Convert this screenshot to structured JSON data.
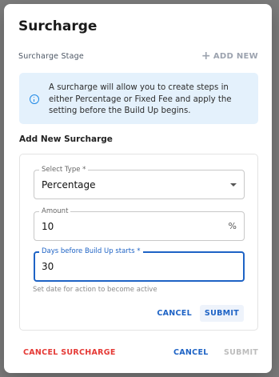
{
  "dialog": {
    "title": "Surcharge",
    "stage_label": "Surcharge Stage",
    "add_new_label": "ADD NEW",
    "info_text": "A surcharge will allow you to create steps in either Percentage or Fixed Fee and apply the setting before the Build Up begins.",
    "section_title": "Add New Surcharge"
  },
  "form": {
    "type": {
      "label": "Select Type *",
      "value": "Percentage"
    },
    "amount": {
      "label": "Amount",
      "value": "10",
      "suffix": "%"
    },
    "days": {
      "label": "Days before Build Up starts *",
      "value": "30"
    },
    "helper_text": "Set date for action to become active",
    "cancel_label": "CANCEL",
    "submit_label": "SUBMIT"
  },
  "footer": {
    "cancel_surcharge_label": "CANCEL SURCHARGE",
    "cancel_label": "CANCEL",
    "submit_label": "SUBMIT"
  },
  "colors": {
    "primary": "#1e63c5",
    "danger": "#e53935",
    "info_bg": "#e4f1fc",
    "disabled": "#bdbdbd"
  },
  "icons": {
    "add": "plus-icon",
    "info": "info-icon",
    "select": "caret-down-icon"
  }
}
